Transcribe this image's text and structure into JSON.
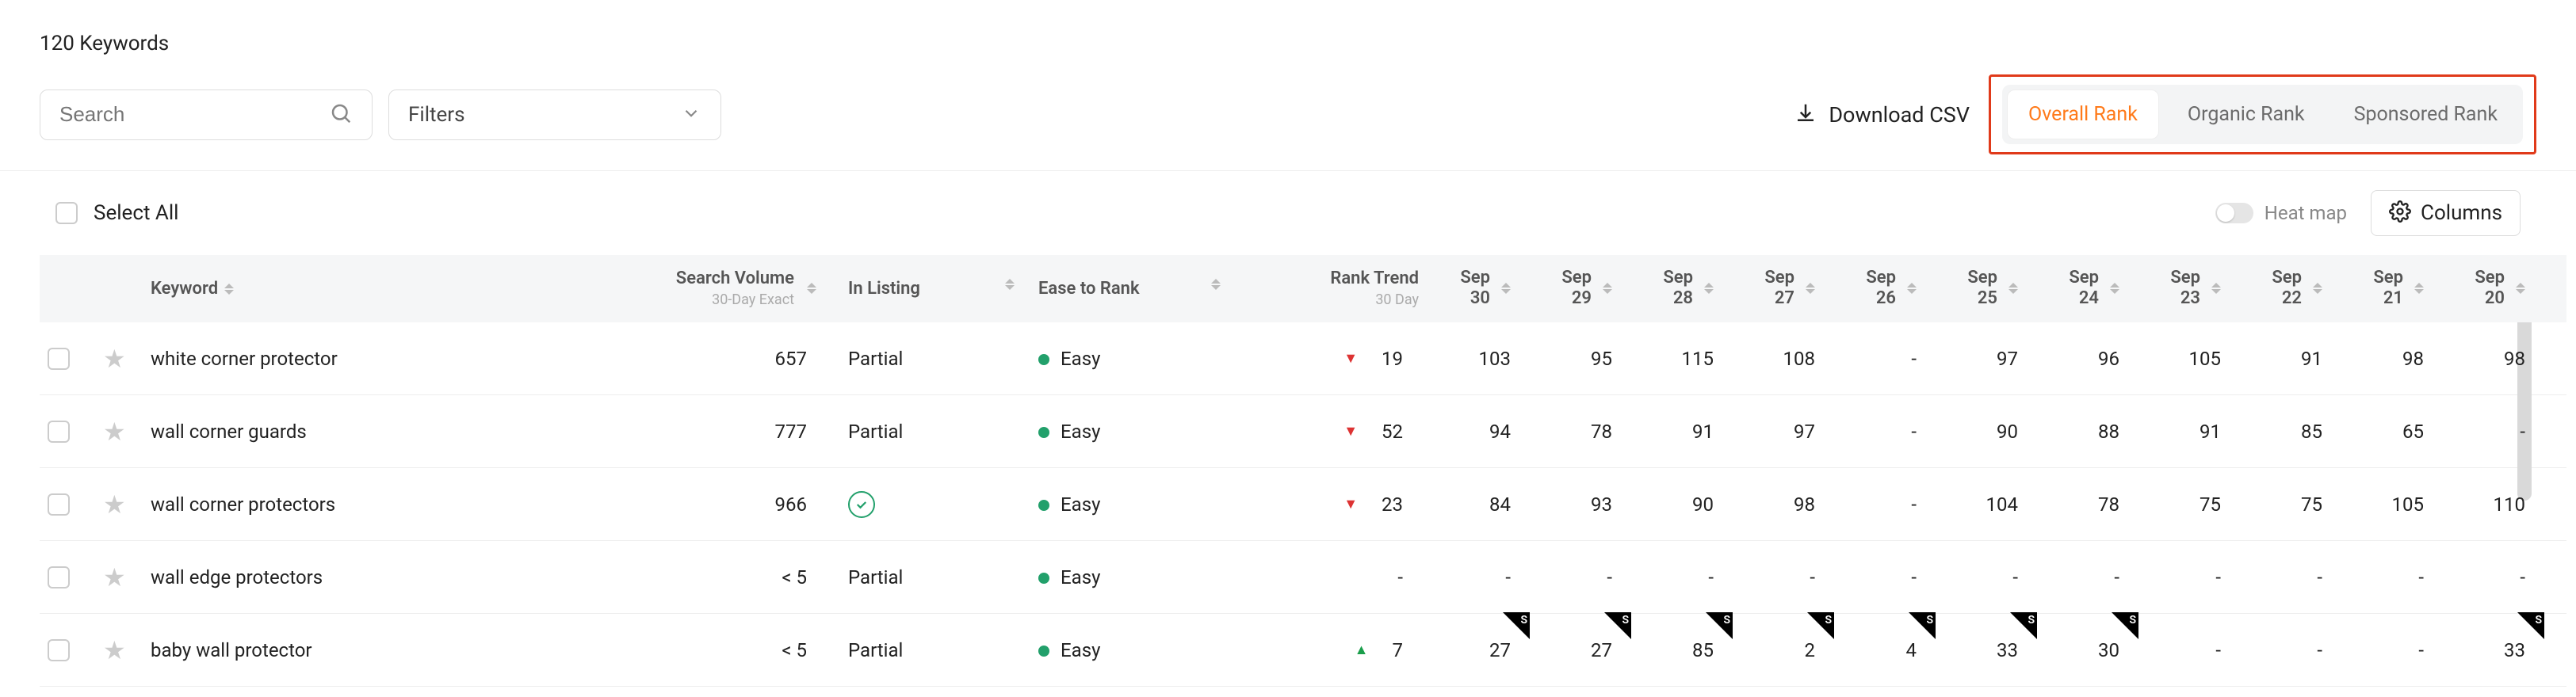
{
  "title": "120 Keywords",
  "search": {
    "placeholder": "Search"
  },
  "filters": {
    "label": "Filters"
  },
  "download": {
    "label": "Download CSV"
  },
  "rankTabs": {
    "overall": "Overall Rank",
    "organic": "Organic Rank",
    "sponsored": "Sponsored Rank"
  },
  "selectAll": "Select All",
  "heatmap": "Heat map",
  "columnsBtn": "Columns",
  "headers": {
    "keyword": "Keyword",
    "searchVol": "Search Volume",
    "searchVolSub": "30-Day Exact",
    "inListing": "In Listing",
    "ease": "Ease to Rank",
    "trend": "Rank Trend",
    "trendSub": "30 Day"
  },
  "dateCols": [
    {
      "top": "Sep",
      "bot": "30"
    },
    {
      "top": "Sep",
      "bot": "29"
    },
    {
      "top": "Sep",
      "bot": "28"
    },
    {
      "top": "Sep",
      "bot": "27"
    },
    {
      "top": "Sep",
      "bot": "26"
    },
    {
      "top": "Sep",
      "bot": "25"
    },
    {
      "top": "Sep",
      "bot": "24"
    },
    {
      "top": "Sep",
      "bot": "23"
    },
    {
      "top": "Sep",
      "bot": "22"
    },
    {
      "top": "Sep",
      "bot": "21"
    },
    {
      "top": "Sep",
      "bot": "20"
    }
  ],
  "rows": [
    {
      "keyword": "white corner protector",
      "sv": "657",
      "listing": "Partial",
      "ease": "Easy",
      "easeColor": "green",
      "trendDir": "down",
      "trendVal": "19",
      "cells": [
        {
          "v": "103"
        },
        {
          "v": "95"
        },
        {
          "v": "115"
        },
        {
          "v": "108"
        },
        {
          "v": "-"
        },
        {
          "v": "97"
        },
        {
          "v": "96"
        },
        {
          "v": "105"
        },
        {
          "v": "91"
        },
        {
          "v": "98"
        },
        {
          "v": "98"
        }
      ]
    },
    {
      "keyword": "wall corner guards",
      "sv": "777",
      "listing": "Partial",
      "ease": "Easy",
      "easeColor": "green",
      "trendDir": "down",
      "trendVal": "52",
      "cells": [
        {
          "v": "94"
        },
        {
          "v": "78"
        },
        {
          "v": "91"
        },
        {
          "v": "97"
        },
        {
          "v": "-"
        },
        {
          "v": "90"
        },
        {
          "v": "88"
        },
        {
          "v": "91"
        },
        {
          "v": "85"
        },
        {
          "v": "65"
        },
        {
          "v": "-"
        }
      ]
    },
    {
      "keyword": "wall corner protectors",
      "sv": "966",
      "listing": "check",
      "ease": "Easy",
      "easeColor": "green",
      "trendDir": "down",
      "trendVal": "23",
      "cells": [
        {
          "v": "84"
        },
        {
          "v": "93"
        },
        {
          "v": "90"
        },
        {
          "v": "98"
        },
        {
          "v": "-"
        },
        {
          "v": "104"
        },
        {
          "v": "78"
        },
        {
          "v": "75"
        },
        {
          "v": "75"
        },
        {
          "v": "105"
        },
        {
          "v": "110"
        }
      ]
    },
    {
      "keyword": "wall edge protectors",
      "sv": "< 5",
      "listing": "Partial",
      "ease": "Easy",
      "easeColor": "green",
      "trendDir": "",
      "trendVal": "-",
      "cells": [
        {
          "v": "-"
        },
        {
          "v": "-"
        },
        {
          "v": "-"
        },
        {
          "v": "-"
        },
        {
          "v": "-"
        },
        {
          "v": "-"
        },
        {
          "v": "-"
        },
        {
          "v": "-"
        },
        {
          "v": "-"
        },
        {
          "v": "-"
        },
        {
          "v": "-"
        }
      ]
    },
    {
      "keyword": "baby wall protector",
      "sv": "< 5",
      "listing": "Partial",
      "ease": "Easy",
      "easeColor": "green",
      "trendDir": "up",
      "trendVal": "7",
      "cells": [
        {
          "v": "27",
          "s": true
        },
        {
          "v": "27",
          "s": true
        },
        {
          "v": "85",
          "s": true
        },
        {
          "v": "2",
          "s": true
        },
        {
          "v": "4",
          "s": true
        },
        {
          "v": "33",
          "s": true
        },
        {
          "v": "30",
          "s": true
        },
        {
          "v": "-"
        },
        {
          "v": "-"
        },
        {
          "v": "-"
        },
        {
          "v": "33",
          "s": true
        }
      ]
    }
  ]
}
